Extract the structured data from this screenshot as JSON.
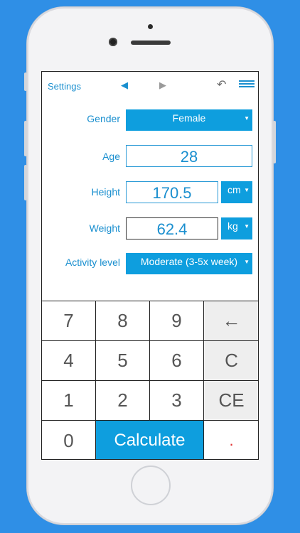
{
  "topbar": {
    "settings_label": "Settings",
    "prev_icon": "◀",
    "next_icon": "▶",
    "undo_icon": "↶"
  },
  "form": {
    "gender": {
      "label": "Gender",
      "value": "Female"
    },
    "age": {
      "label": "Age",
      "value": "28"
    },
    "height": {
      "label": "Height",
      "value": "170.5",
      "unit": "cm"
    },
    "weight": {
      "label": "Weight",
      "value": "62.4",
      "unit": "kg"
    },
    "activity": {
      "label": "Activity level",
      "value": "Moderate (3-5x week)"
    }
  },
  "keypad": {
    "k7": "7",
    "k8": "8",
    "k9": "9",
    "backspace": "←",
    "k4": "4",
    "k5": "5",
    "k6": "6",
    "clear": "C",
    "k1": "1",
    "k2": "2",
    "k3": "3",
    "clear_entry": "CE",
    "k0": "0",
    "calculate": "Calculate",
    "decimal": "."
  },
  "colors": {
    "accent": "#0e9ede",
    "background": "#2f8fe6"
  }
}
